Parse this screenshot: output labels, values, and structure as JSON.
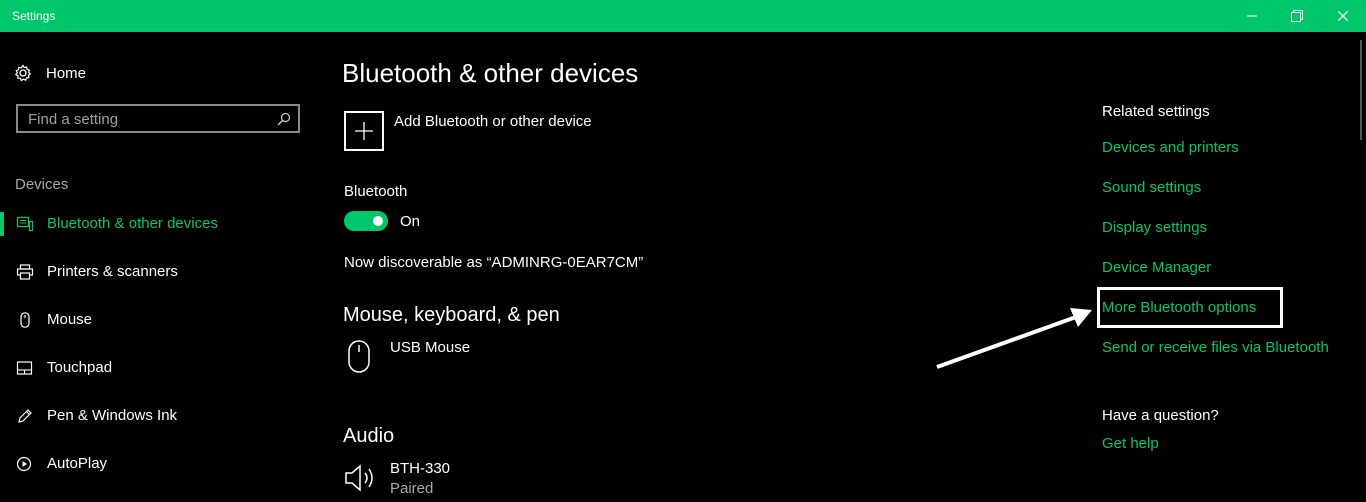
{
  "window": {
    "title": "Settings"
  },
  "sidebar": {
    "home_label": "Home",
    "search_placeholder": "Find a setting",
    "section_label": "Devices",
    "items": [
      {
        "label": "Bluetooth & other devices",
        "icon": "bluetooth-devices-icon",
        "active": true
      },
      {
        "label": "Printers & scanners",
        "icon": "printer-icon"
      },
      {
        "label": "Mouse",
        "icon": "mouse-icon"
      },
      {
        "label": "Touchpad",
        "icon": "touchpad-icon"
      },
      {
        "label": "Pen & Windows Ink",
        "icon": "pen-icon"
      },
      {
        "label": "AutoPlay",
        "icon": "autoplay-icon"
      }
    ]
  },
  "main": {
    "title": "Bluetooth & other devices",
    "add_device_label": "Add Bluetooth or other device",
    "bluetooth_label": "Bluetooth",
    "toggle_state": "On",
    "discoverable_text": "Now discoverable as “ADMINRG-0EAR7CM”",
    "mouse_section": {
      "title": "Mouse, keyboard, & pen",
      "devices": [
        {
          "name": "USB Mouse",
          "icon": "mouse-icon"
        }
      ]
    },
    "audio_section": {
      "title": "Audio",
      "devices": [
        {
          "name": "BTH-330",
          "status": "Paired",
          "icon": "speaker-icon"
        }
      ]
    }
  },
  "related": {
    "title": "Related settings",
    "links": [
      "Devices and printers",
      "Sound settings",
      "Display settings",
      "Device Manager",
      "More Bluetooth options",
      "Send or receive files via Bluetooth"
    ],
    "question": "Have a question?",
    "help_link": "Get help"
  },
  "colors": {
    "accent": "#00c76b",
    "background": "#000000",
    "highlight": "#ffffff"
  }
}
